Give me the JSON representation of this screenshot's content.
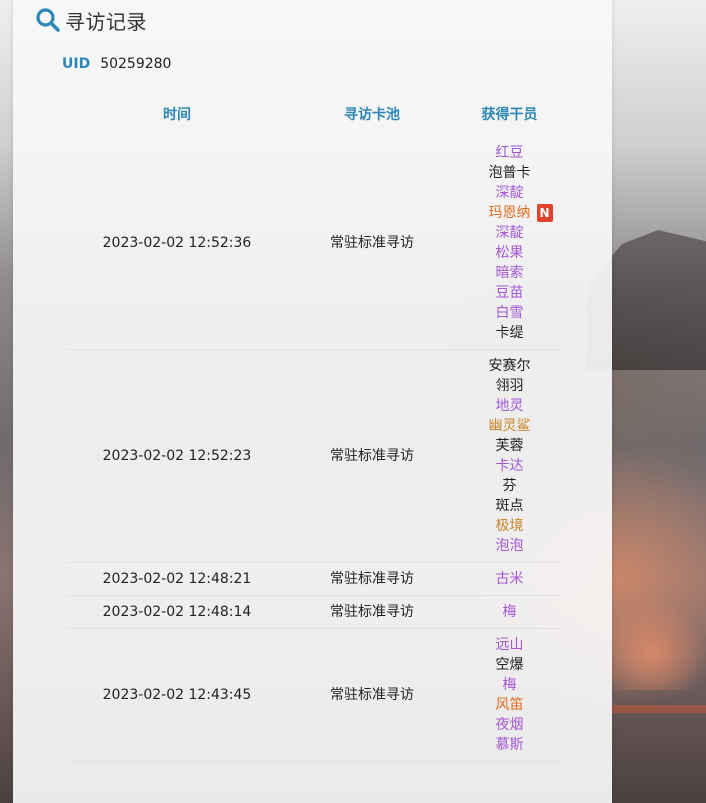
{
  "header": {
    "title": "寻访记录",
    "icon": "search-icon"
  },
  "uid": {
    "label": "UID",
    "value": "50259280"
  },
  "colors": {
    "accent": "#2c87b8",
    "rarity_6": "#e26b1f",
    "rarity_5": "#c8862d",
    "rarity_4": "#a356d6",
    "rarity_3": "#222222",
    "new_badge": "#e0442f"
  },
  "columns": [
    "时间",
    "寻访卡池",
    "获得干员"
  ],
  "records": [
    {
      "time": "2023-02-02 12:52:36",
      "pool": "常驻标准寻访",
      "operators": [
        {
          "name": "红豆",
          "rarity": 4
        },
        {
          "name": "泡普卡",
          "rarity": 3
        },
        {
          "name": "深靛",
          "rarity": 4
        },
        {
          "name": "玛恩纳",
          "rarity": 6,
          "new": "N"
        },
        {
          "name": "深靛",
          "rarity": 4
        },
        {
          "name": "松果",
          "rarity": 4
        },
        {
          "name": "暗索",
          "rarity": 4
        },
        {
          "name": "豆苗",
          "rarity": 4
        },
        {
          "name": "白雪",
          "rarity": 4
        },
        {
          "name": "卡缇",
          "rarity": 3
        }
      ]
    },
    {
      "time": "2023-02-02 12:52:23",
      "pool": "常驻标准寻访",
      "operators": [
        {
          "name": "安赛尔",
          "rarity": 3
        },
        {
          "name": "翎羽",
          "rarity": 3
        },
        {
          "name": "地灵",
          "rarity": 4
        },
        {
          "name": "幽灵鲨",
          "rarity": 5
        },
        {
          "name": "芙蓉",
          "rarity": 3
        },
        {
          "name": "卡达",
          "rarity": 4
        },
        {
          "name": "芬",
          "rarity": 3
        },
        {
          "name": "斑点",
          "rarity": 3
        },
        {
          "name": "极境",
          "rarity": 5
        },
        {
          "name": "泡泡",
          "rarity": 4
        }
      ]
    },
    {
      "time": "2023-02-02 12:48:21",
      "pool": "常驻标准寻访",
      "operators": [
        {
          "name": "古米",
          "rarity": 4
        }
      ]
    },
    {
      "time": "2023-02-02 12:48:14",
      "pool": "常驻标准寻访",
      "operators": [
        {
          "name": "梅",
          "rarity": 4
        }
      ]
    },
    {
      "time": "2023-02-02 12:43:45",
      "pool": "常驻标准寻访",
      "operators": [
        {
          "name": "远山",
          "rarity": 4
        },
        {
          "name": "空爆",
          "rarity": 3
        },
        {
          "name": "梅",
          "rarity": 4
        },
        {
          "name": "风笛",
          "rarity": 6
        },
        {
          "name": "夜烟",
          "rarity": 4
        },
        {
          "name": "慕斯",
          "rarity": 4
        }
      ]
    }
  ]
}
